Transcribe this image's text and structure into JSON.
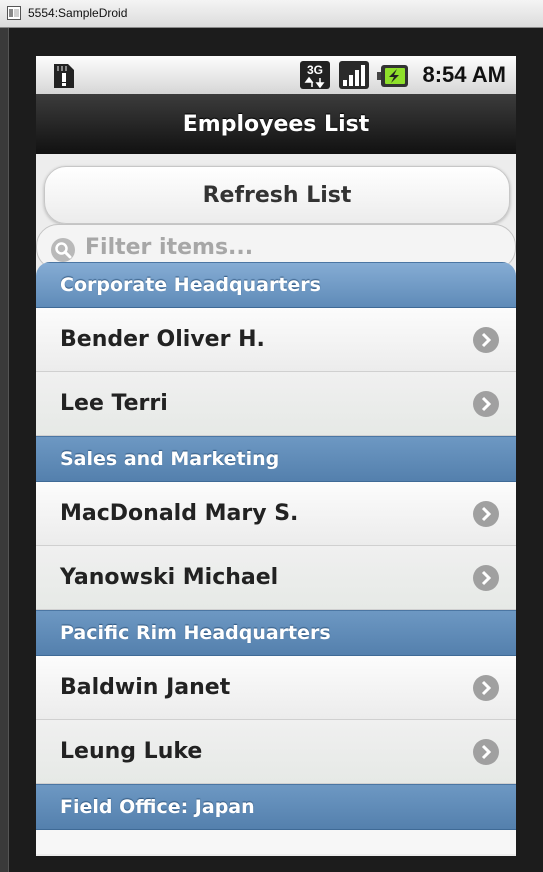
{
  "window": {
    "title": "5554:SampleDroid"
  },
  "status_bar": {
    "time": "8:54 AM",
    "network": "3G"
  },
  "header": {
    "title": "Employees List"
  },
  "refresh_button": {
    "label": "Refresh List"
  },
  "filter": {
    "placeholder": "Filter items..."
  },
  "groups": [
    {
      "name": "Corporate Headquarters",
      "employees": [
        "Bender Oliver H.",
        "Lee Terri"
      ]
    },
    {
      "name": "Sales and Marketing",
      "employees": [
        "MacDonald Mary S.",
        "Yanowski Michael"
      ]
    },
    {
      "name": "Pacific Rim Headquarters",
      "employees": [
        "Baldwin Janet",
        "Leung Luke"
      ]
    },
    {
      "name": "Field Office: Japan",
      "employees": []
    }
  ],
  "colors": {
    "divider": "#5a86b3",
    "header": "#1f1f1f",
    "chevron": "#9a9a9a"
  }
}
